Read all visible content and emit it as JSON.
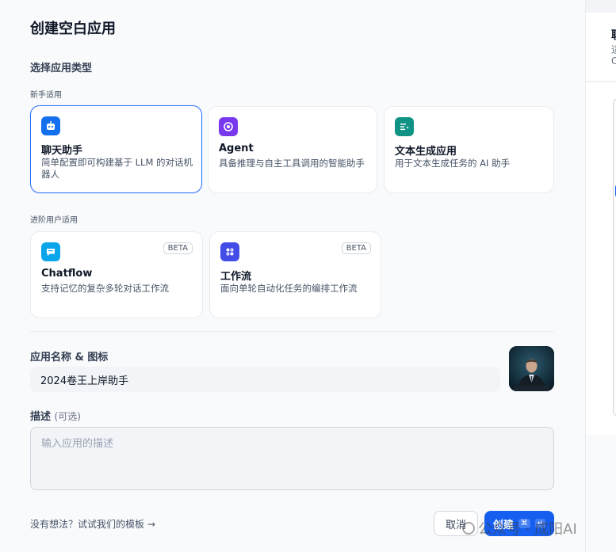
{
  "dialog": {
    "title": "创建空白应用",
    "section_title": "选择应用类型",
    "group_beginner": "新手适用",
    "group_advanced": "进阶用户适用"
  },
  "app_types": {
    "chat": {
      "name": "聊天助手",
      "desc": "简单配置即可构建基于 LLM 的对话机器人",
      "icon": "robot-icon",
      "color": "#1570ef",
      "selected": true
    },
    "agent": {
      "name": "Agent",
      "desc": "具备推理与自主工具调用的智能助手",
      "icon": "agent-icon",
      "color": "#7839ee"
    },
    "completion": {
      "name": "文本生成应用",
      "desc": "用于文本生成任务的 AI 助手",
      "icon": "text-generation-icon",
      "color": "#0e9384"
    },
    "chatflow": {
      "name": "Chatflow",
      "desc": "支持记忆的复杂多轮对话工作流",
      "badge": "BETA",
      "icon": "chatflow-icon",
      "color": "#0ba5ec"
    },
    "workflow": {
      "name": "工作流",
      "desc": "面向单轮自动化任务的编排工作流",
      "badge": "BETA",
      "icon": "workflow-icon",
      "color": "#444ce7"
    }
  },
  "form": {
    "name_label": "应用名称 & 图标",
    "name_value": "2024卷王上岸助手",
    "desc_label": "描述",
    "desc_optional": "(可选)",
    "desc_placeholder": "输入应用的描述"
  },
  "footer": {
    "template_link": "没有想法？试试我们的模板",
    "template_arrow": "→",
    "cancel_label": "取消",
    "create_label": "创建",
    "shortcut_cmd": "⌘",
    "shortcut_enter": "↵"
  },
  "side_preview": {
    "title": "聊",
    "line1": "适",
    "line2": "C"
  },
  "watermark": {
    "text": "公众号 · 成阳AI"
  }
}
